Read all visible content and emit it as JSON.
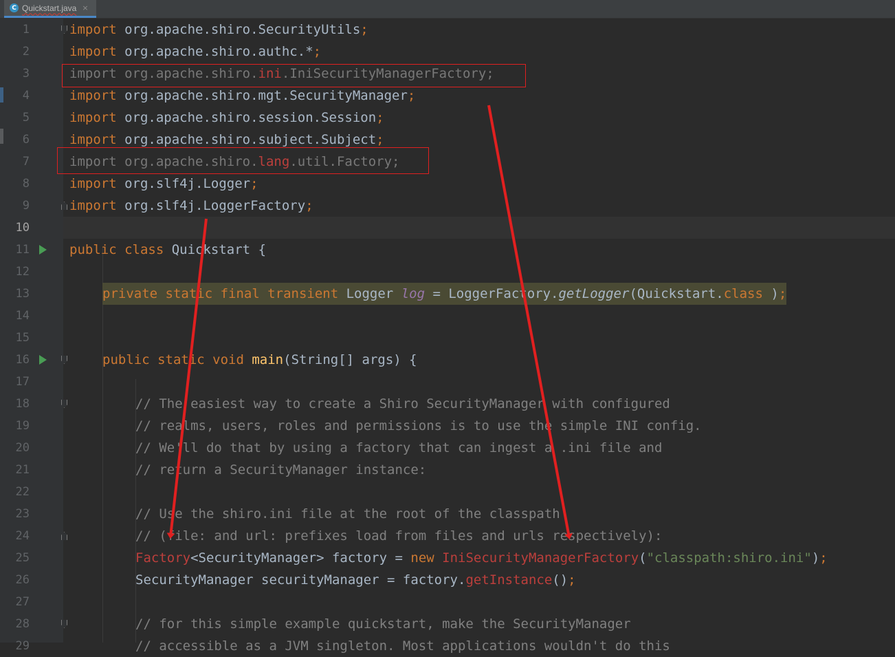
{
  "tab": {
    "filename": "Quickstart.java",
    "icon": "java-class-icon",
    "close_glyph": "×"
  },
  "lines": [
    {
      "n": "1",
      "segs": [
        [
          "k",
          "import"
        ],
        [
          "",
          "org.apache.shiro.SecurityUtils"
        ],
        [
          "k",
          ";"
        ]
      ]
    },
    {
      "n": "2",
      "segs": [
        [
          "k",
          "import"
        ],
        [
          "",
          "org.apache.shiro.authc.*"
        ],
        [
          "k",
          ";"
        ]
      ]
    },
    {
      "n": "3",
      "segs": [
        [
          "dim",
          "import org.apache.shiro."
        ],
        [
          "err",
          "ini"
        ],
        [
          "dim",
          ".IniSecurityManagerFactory;"
        ]
      ]
    },
    {
      "n": "4",
      "segs": [
        [
          "k",
          "import"
        ],
        [
          "",
          "org.apache.shiro.mgt.SecurityManager"
        ],
        [
          "k",
          ";"
        ]
      ]
    },
    {
      "n": "5",
      "segs": [
        [
          "k",
          "import"
        ],
        [
          "",
          "org.apache.shiro.session.Session"
        ],
        [
          "k",
          ";"
        ]
      ]
    },
    {
      "n": "6",
      "segs": [
        [
          "k",
          "import"
        ],
        [
          "",
          "org.apache.shiro.subject.Subject"
        ],
        [
          "k",
          ";"
        ]
      ]
    },
    {
      "n": "7",
      "segs": [
        [
          "dim",
          "import org.apache.shiro."
        ],
        [
          "err",
          "lang"
        ],
        [
          "dim",
          ".util.Factory;"
        ]
      ]
    },
    {
      "n": "8",
      "segs": [
        [
          "k",
          "import"
        ],
        [
          "",
          "org.slf4j.Logger"
        ],
        [
          "k",
          ";"
        ]
      ]
    },
    {
      "n": "9",
      "segs": [
        [
          "k",
          "import"
        ],
        [
          "",
          "org.slf4j.LoggerFactory"
        ],
        [
          "k",
          ";"
        ]
      ]
    },
    {
      "n": "10",
      "segs": []
    },
    {
      "n": "11",
      "segs": [
        [
          "k",
          "public class"
        ],
        [
          "",
          "Quickstart {"
        ]
      ]
    },
    {
      "n": "12",
      "segs": []
    },
    {
      "n": "13",
      "indent": 4,
      "highlight": true,
      "segs": [
        [
          "k",
          "private static final transient"
        ],
        [
          "",
          " Logger "
        ],
        [
          "it",
          "log"
        ],
        [
          "",
          " = LoggerFactory."
        ],
        [
          "mi",
          "getLogger"
        ],
        [
          "",
          "(Quickstart."
        ],
        [
          "k",
          "class"
        ],
        [
          "",
          ")"
        ],
        [
          "k",
          ";"
        ]
      ]
    },
    {
      "n": "14",
      "segs": []
    },
    {
      "n": "15",
      "segs": []
    },
    {
      "n": "16",
      "indent": 4,
      "segs": [
        [
          "k",
          "public static void"
        ],
        [
          "",
          " "
        ],
        [
          "fn",
          "main"
        ],
        [
          "",
          "(String[] args) {"
        ]
      ]
    },
    {
      "n": "17",
      "segs": []
    },
    {
      "n": "18",
      "indent": 8,
      "segs": [
        [
          "cm",
          "// The easiest way to create a Shiro SecurityManager with configured"
        ]
      ]
    },
    {
      "n": "19",
      "indent": 8,
      "segs": [
        [
          "cm",
          "// realms, users, roles and permissions is to use the simple INI config."
        ]
      ]
    },
    {
      "n": "20",
      "indent": 8,
      "segs": [
        [
          "cm",
          "// We'll do that by using a factory that can ingest a .ini file and"
        ]
      ]
    },
    {
      "n": "21",
      "indent": 8,
      "segs": [
        [
          "cm",
          "// return a SecurityManager instance:"
        ]
      ]
    },
    {
      "n": "22",
      "segs": []
    },
    {
      "n": "23",
      "indent": 8,
      "segs": [
        [
          "cm",
          "// Use the shiro.ini file at the root of the classpath"
        ]
      ]
    },
    {
      "n": "24",
      "indent": 8,
      "segs": [
        [
          "cm",
          "// (file: and url: prefixes load from files and urls respectively):"
        ]
      ]
    },
    {
      "n": "25",
      "indent": 8,
      "segs": [
        [
          "err",
          "Factory"
        ],
        [
          "",
          "<SecurityManager> factory = "
        ],
        [
          "k",
          "new"
        ],
        [
          "",
          " "
        ],
        [
          "err",
          "IniSecurityManagerFactory"
        ],
        [
          "",
          "("
        ],
        [
          "s",
          "\"classpath:shiro.ini\""
        ],
        [
          "",
          ")"
        ],
        [
          "k",
          ";"
        ]
      ]
    },
    {
      "n": "26",
      "indent": 8,
      "segs": [
        [
          "",
          "SecurityManager securityManager = factory."
        ],
        [
          "err",
          "getInstance"
        ],
        [
          "",
          "()"
        ],
        [
          "k",
          ";"
        ]
      ]
    },
    {
      "n": "27",
      "segs": []
    },
    {
      "n": "28",
      "indent": 8,
      "segs": [
        [
          "cm",
          "// for this simple example quickstart, make the SecurityManager"
        ]
      ]
    },
    {
      "n": "29",
      "indent": 8,
      "segs": [
        [
          "cm",
          "// accessible as a JVM singleton. Most applications wouldn't do this"
        ]
      ]
    }
  ],
  "current_line": "10",
  "run_icons": [
    "run-gutter-icon-line-11",
    "run-gutter-icon-line-16"
  ],
  "annotation_color": "#e02020"
}
